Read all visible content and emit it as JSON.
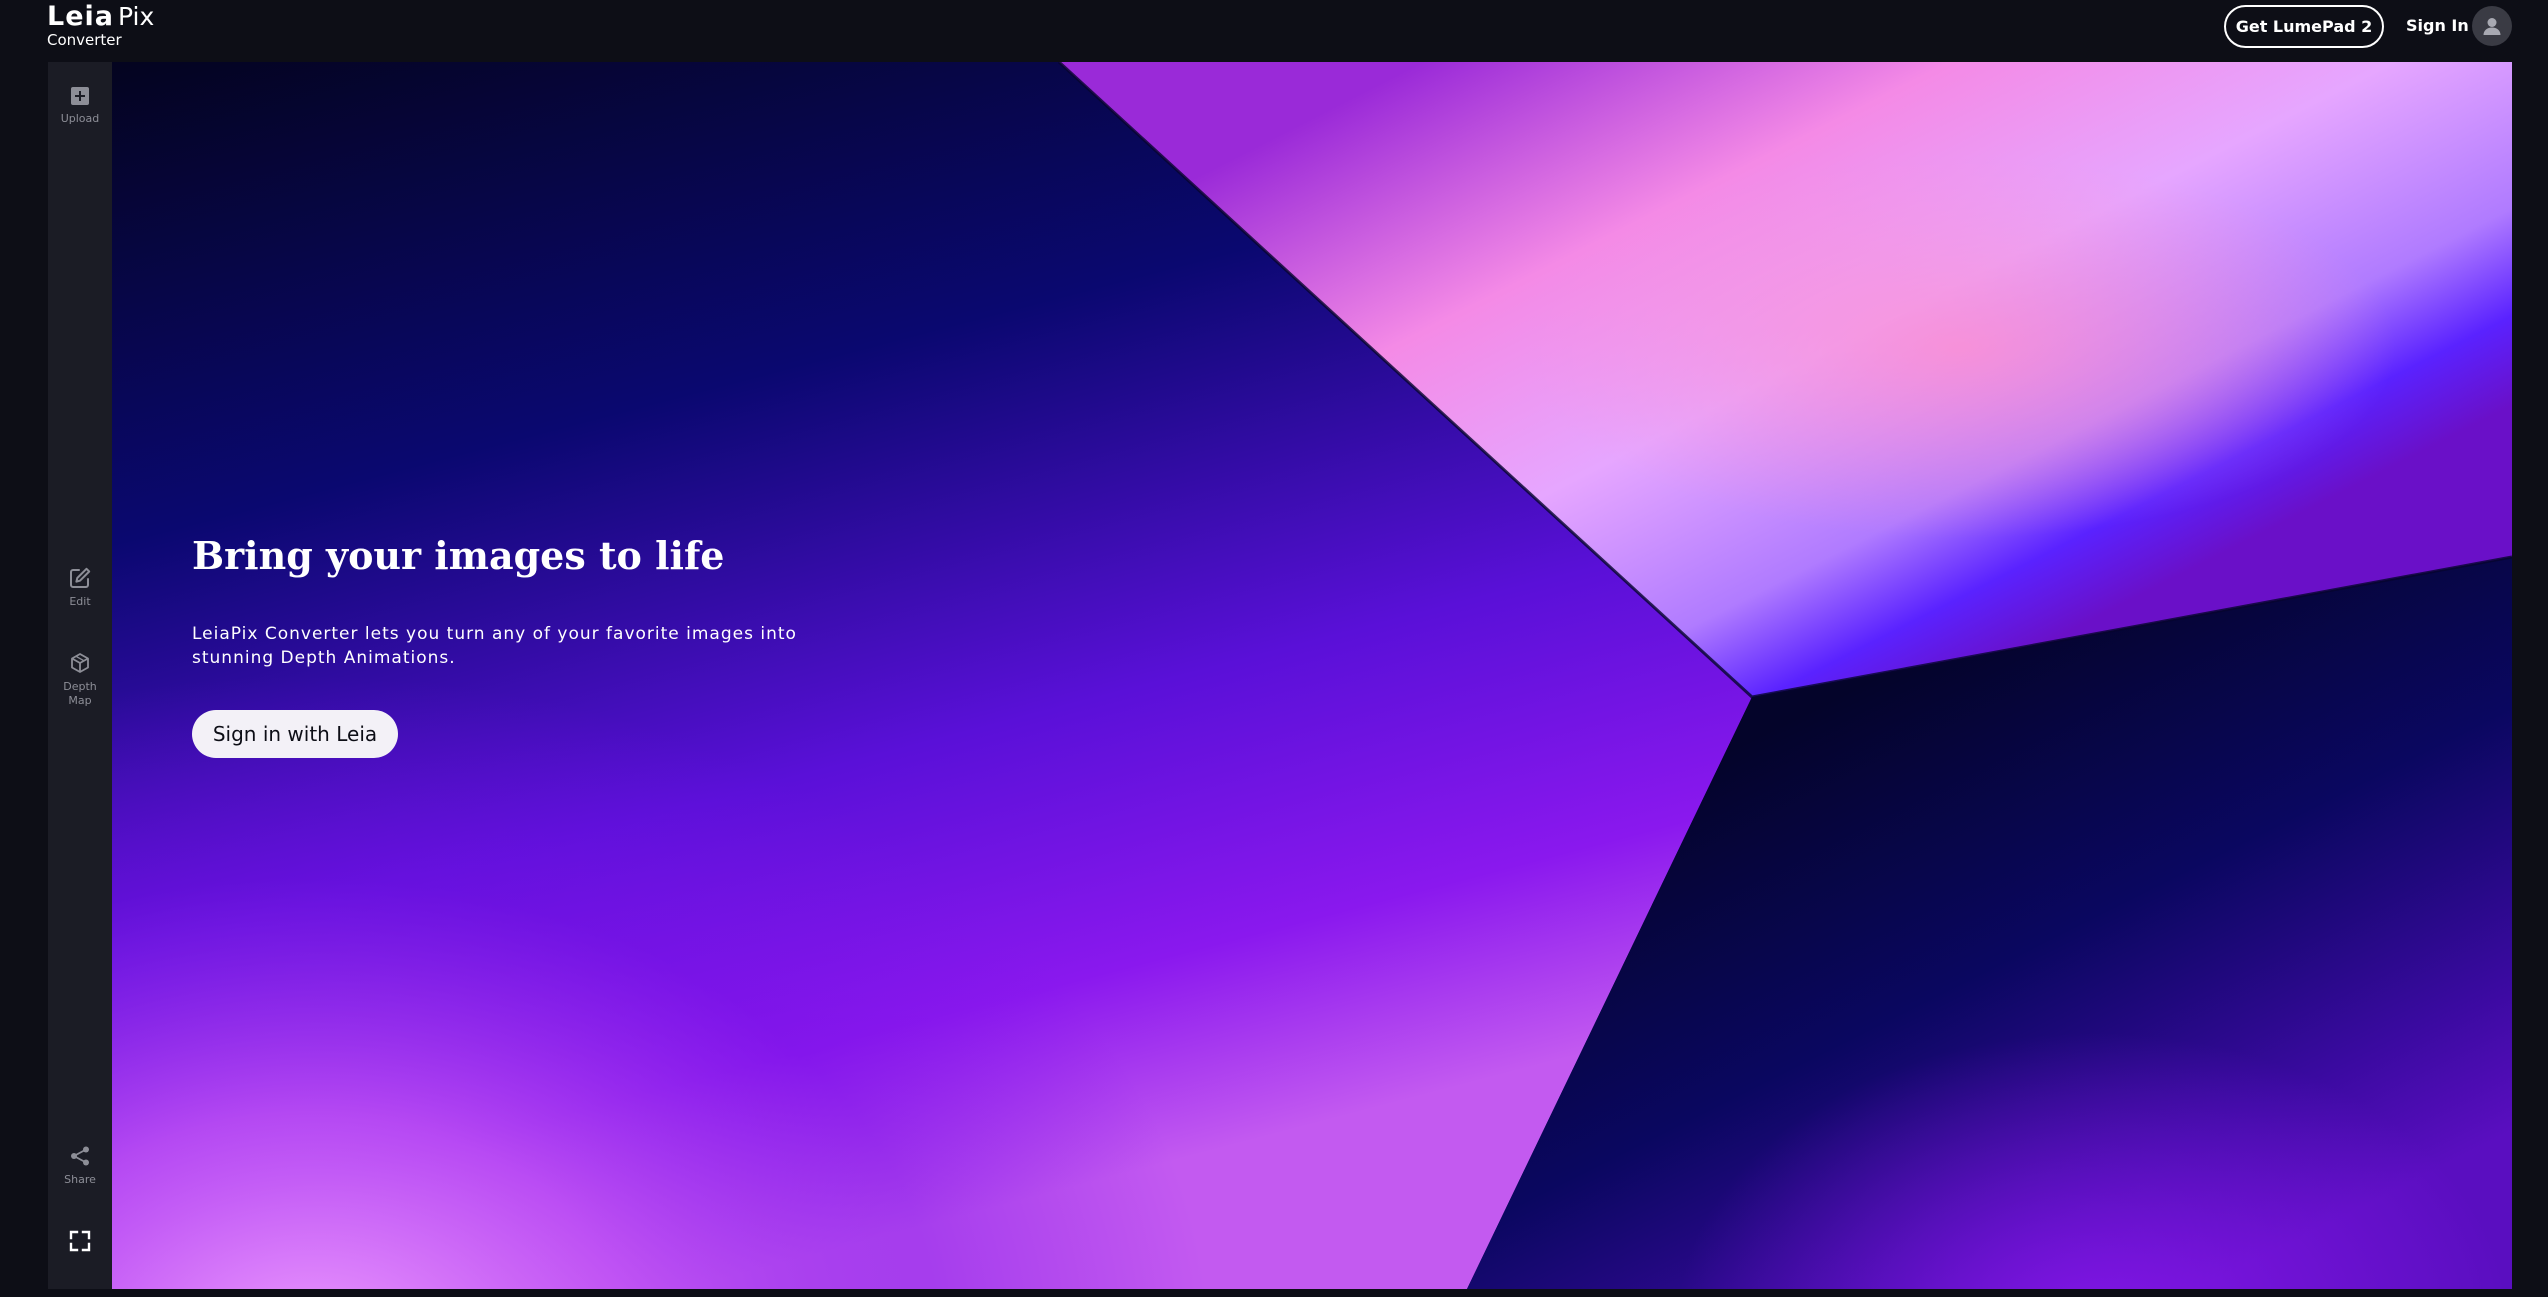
{
  "header": {
    "brand_leia": "Leia",
    "brand_pix": "Pix",
    "brand_sub": "Converter",
    "get_lumepad_label": "Get LumePad 2",
    "sign_in_label": "Sign In",
    "avatar_icon": "user-avatar-icon"
  },
  "sidebar": {
    "tools": [
      {
        "label": "Upload",
        "icon": "plus-square-icon"
      },
      {
        "label": "Edit",
        "icon": "pencil-square-icon"
      },
      {
        "label": "Depth Map",
        "icon": "cube-layers-icon"
      },
      {
        "label": "Share",
        "icon": "share-icon"
      },
      {
        "label": "",
        "icon": "fullscreen-icon"
      }
    ]
  },
  "hero": {
    "title": "Bring your images to life",
    "description": "LeiaPix Converter lets you turn any of your favorite images into stunning Depth Animations.",
    "cta_label": "Sign in with Leia"
  },
  "colors": {
    "page_bg": "#0d0e16",
    "rail_bg": "#1b1c25",
    "hero_dark": "#05052b",
    "hero_purple": "#7a12e8",
    "hero_pink": "#f69bf5",
    "cta_bg": "#f3f1f7"
  }
}
